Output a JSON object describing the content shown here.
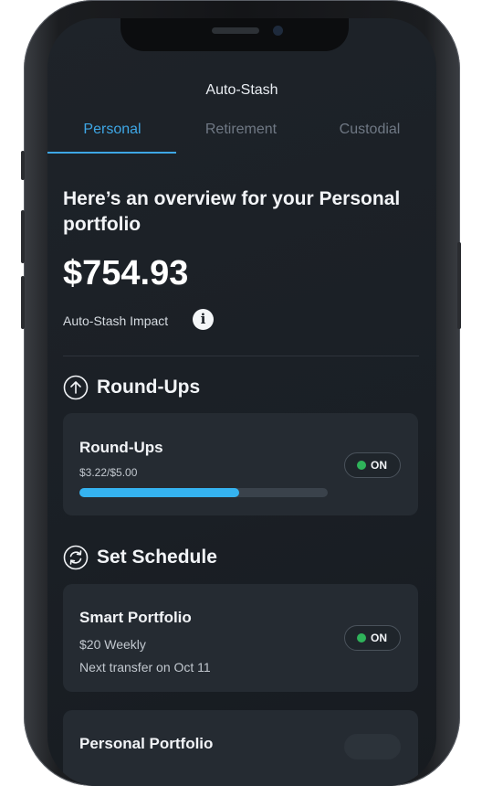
{
  "header": {
    "title": "Auto-Stash"
  },
  "tabs": [
    {
      "label": "Personal",
      "active": true
    },
    {
      "label": "Retirement",
      "active": false
    },
    {
      "label": "Custodial",
      "active": false
    }
  ],
  "overview": {
    "heading": "Here’s an overview for your Personal portfolio",
    "amount": "$754.93",
    "impact_label": "Auto-Stash Impact",
    "info_icon": "info-icon"
  },
  "round_ups_section": {
    "title": "Round-Ups",
    "icon": "arrow-up-circle-icon",
    "card": {
      "title": "Round-Ups",
      "progress_text": "$3.22/$5.00",
      "progress_fraction": 0.644,
      "toggle_label": "ON"
    }
  },
  "schedule_section": {
    "title": "Set Schedule",
    "icon": "refresh-circle-icon",
    "cards": [
      {
        "title": "Smart Portfolio",
        "amount": "$20 Weekly",
        "next": "Next transfer on Oct 11",
        "toggle_label": "ON"
      },
      {
        "title": "Personal Portfolio"
      }
    ]
  },
  "colors": {
    "accent": "#3ea7e6",
    "progress": "#35b3f0",
    "on_dot": "#2fb35a",
    "background": "#1a1f25",
    "card": "#252b32"
  }
}
